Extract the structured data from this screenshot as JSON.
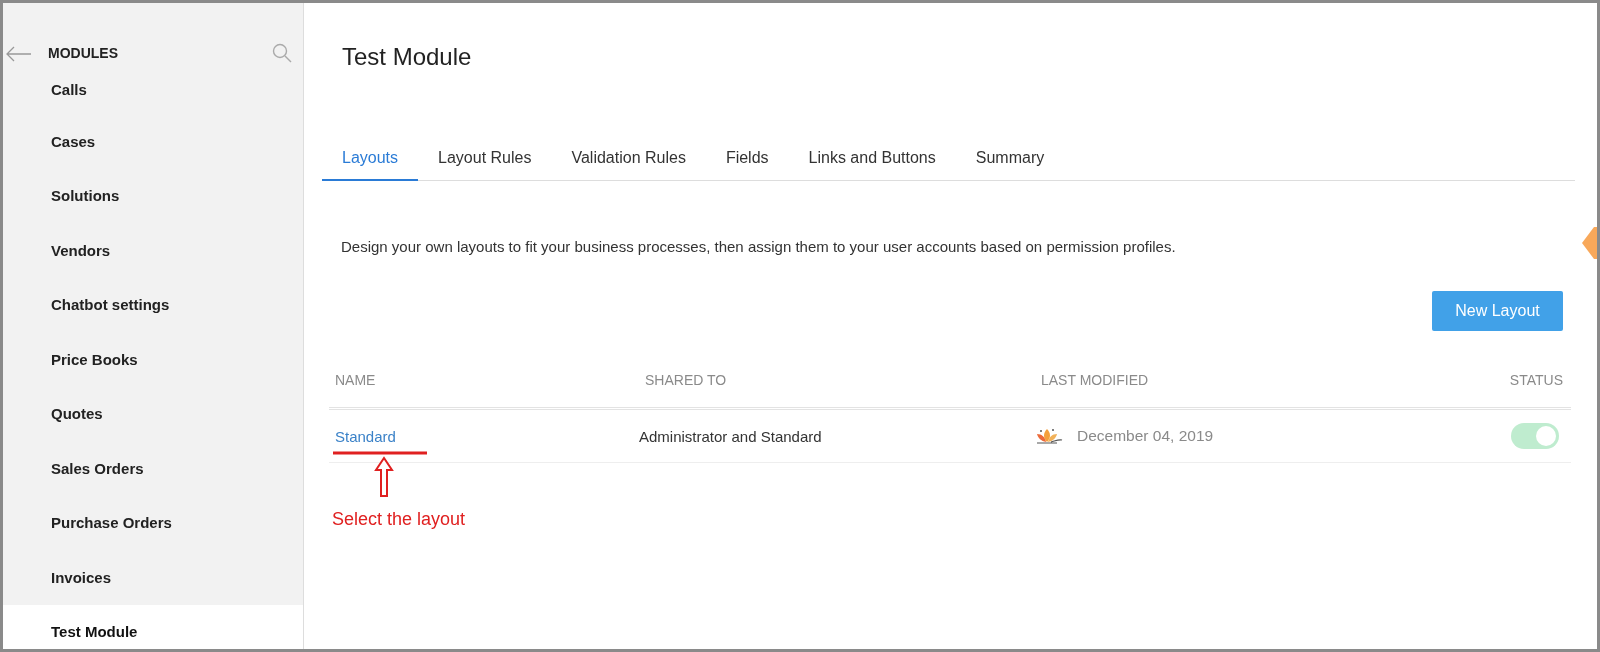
{
  "sidebar": {
    "title": "MODULES",
    "items": [
      {
        "label": "Calls",
        "selected": false
      },
      {
        "label": "Cases",
        "selected": false
      },
      {
        "label": "Solutions",
        "selected": false
      },
      {
        "label": "Vendors",
        "selected": false
      },
      {
        "label": "Chatbot settings",
        "selected": false
      },
      {
        "label": "Price Books",
        "selected": false
      },
      {
        "label": "Quotes",
        "selected": false
      },
      {
        "label": "Sales Orders",
        "selected": false
      },
      {
        "label": "Purchase Orders",
        "selected": false
      },
      {
        "label": "Invoices",
        "selected": false
      },
      {
        "label": "Test Module",
        "selected": true
      }
    ]
  },
  "page_title": "Test Module",
  "tabs": [
    {
      "label": "Layouts",
      "selected": true
    },
    {
      "label": "Layout Rules",
      "selected": false
    },
    {
      "label": "Validation Rules",
      "selected": false
    },
    {
      "label": "Fields",
      "selected": false
    },
    {
      "label": "Links and Buttons",
      "selected": false
    },
    {
      "label": "Summary",
      "selected": false
    }
  ],
  "description": "Design your own layouts to fit your business processes, then assign them to your user accounts based on permission profiles.",
  "new_button": "New Layout",
  "table": {
    "columns": [
      "NAME",
      "SHARED TO",
      "LAST MODIFIED",
      "STATUS"
    ],
    "rows": [
      {
        "name": "Standard",
        "shared_to": "Administrator and Standard",
        "last_modified": "December 04, 2019",
        "status_on": true
      }
    ]
  },
  "annotation": {
    "text": "Select the layout"
  }
}
